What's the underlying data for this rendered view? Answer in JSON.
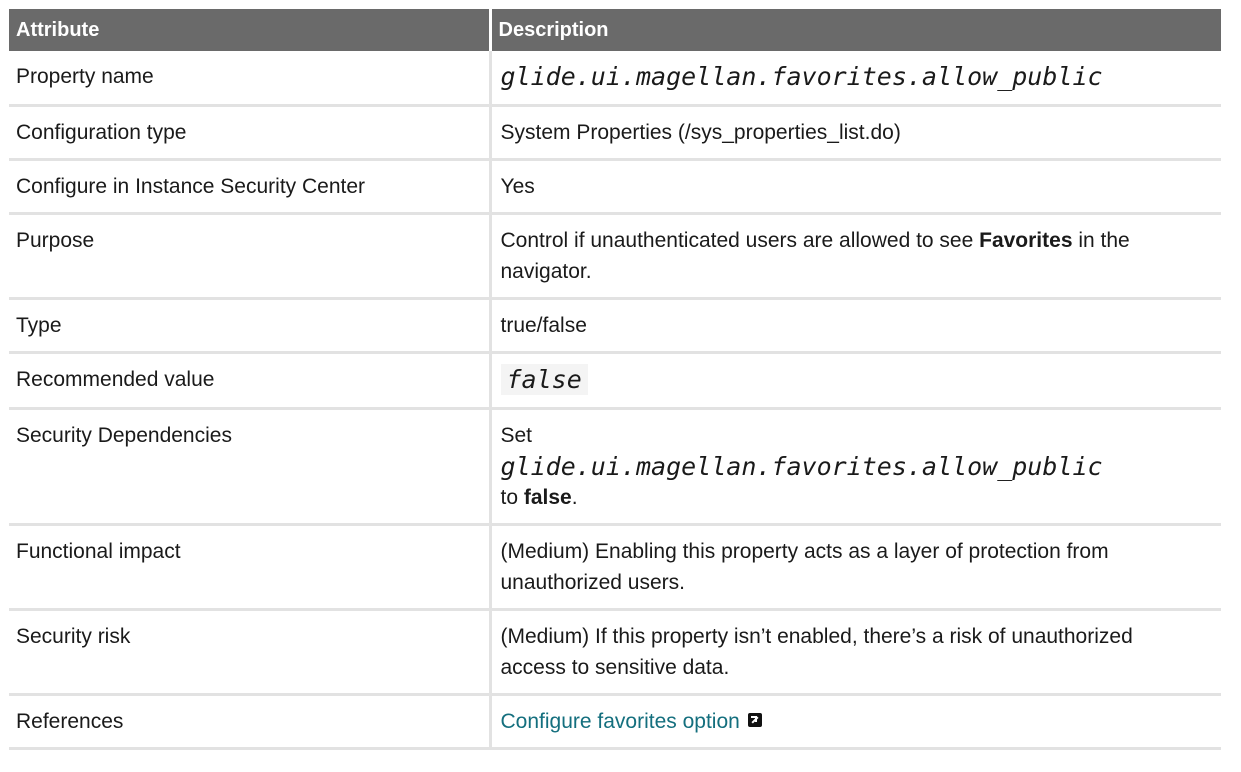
{
  "table": {
    "headers": [
      "Attribute",
      "Description"
    ],
    "rows": {
      "property_name": {
        "attribute": "Property name",
        "value": "glide.ui.magellan.favorites.allow_public"
      },
      "configuration_type": {
        "attribute": "Configuration type",
        "value": "System Properties (/sys_properties_list.do)"
      },
      "configure_in_isc": {
        "attribute": "Configure in Instance Security Center",
        "value": "Yes"
      },
      "purpose": {
        "attribute": "Purpose",
        "value_before": "Control if unauthenticated users are allowed to see ",
        "value_bold": "Favorites",
        "value_after": " in the navigator."
      },
      "type": {
        "attribute": "Type",
        "value": "true/false"
      },
      "recommended_value": {
        "attribute": "Recommended value",
        "value": "false"
      },
      "security_dependencies": {
        "attribute": "Security Dependencies",
        "value_set": "Set",
        "value_code": "glide.ui.magellan.favorites.allow_public",
        "value_to": "to ",
        "value_bold": "false",
        "value_end": "."
      },
      "functional_impact": {
        "attribute": "Functional impact",
        "value": "(Medium) Enabling this property acts as a layer of protection from unauthorized users."
      },
      "security_risk": {
        "attribute": "Security risk",
        "value": "(Medium) If this property isn’t enabled, there’s a risk of unauthorized access to sensitive data."
      },
      "references": {
        "attribute": "References",
        "link_text": "Configure favorites option",
        "link_icon": "external-link-icon"
      }
    }
  },
  "colors": {
    "header_bg": "#6a6a6a",
    "header_text": "#ffffff",
    "border": "#e2e2e2",
    "link": "#146f7e"
  }
}
